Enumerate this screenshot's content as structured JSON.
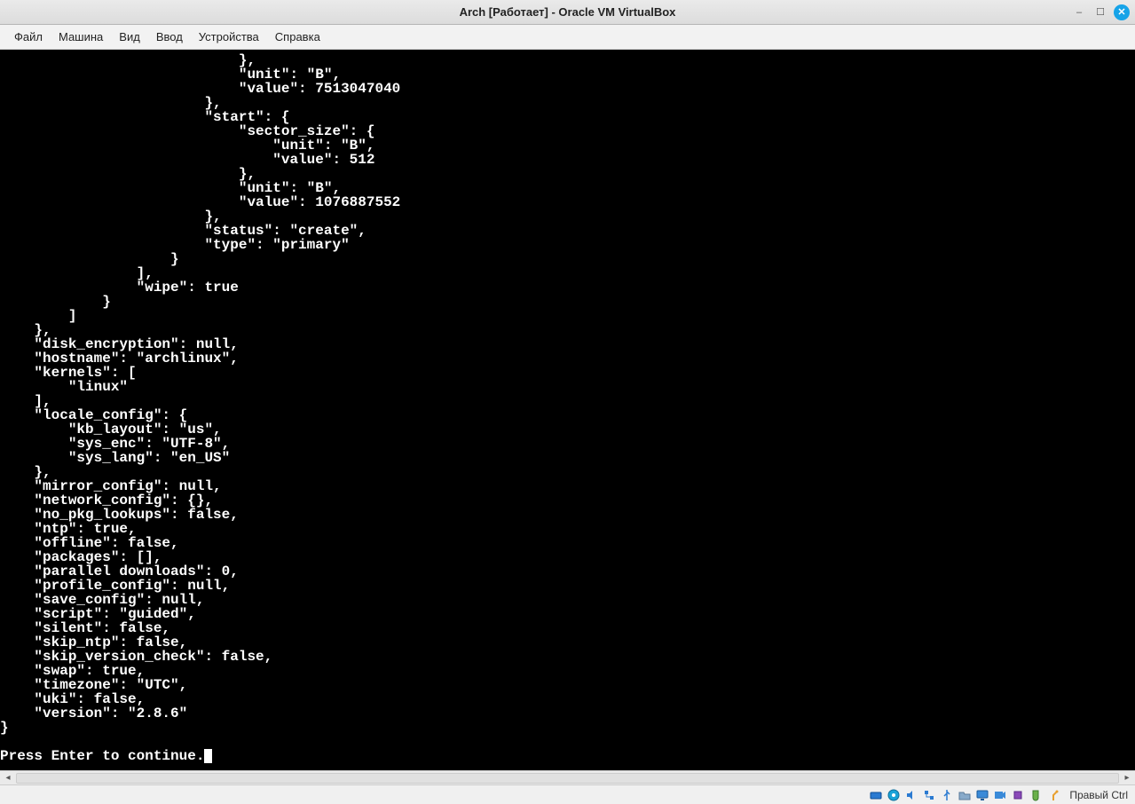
{
  "window": {
    "title": "Arch [Работает] - Oracle VM VirtualBox"
  },
  "menu": {
    "file": "Файл",
    "machine": "Машина",
    "view": "Вид",
    "input": "Ввод",
    "devices": "Устройства",
    "help": "Справка"
  },
  "terminal": {
    "lines": [
      "                            },",
      "                            \"unit\": \"B\",",
      "                            \"value\": 7513047040",
      "                        },",
      "                        \"start\": {",
      "                            \"sector_size\": {",
      "                                \"unit\": \"B\",",
      "                                \"value\": 512",
      "                            },",
      "                            \"unit\": \"B\",",
      "                            \"value\": 1076887552",
      "                        },",
      "                        \"status\": \"create\",",
      "                        \"type\": \"primary\"",
      "                    }",
      "                ],",
      "                \"wipe\": true",
      "            }",
      "        ]",
      "    },",
      "    \"disk_encryption\": null,",
      "    \"hostname\": \"archlinux\",",
      "    \"kernels\": [",
      "        \"linux\"",
      "    ],",
      "    \"locale_config\": {",
      "        \"kb_layout\": \"us\",",
      "        \"sys_enc\": \"UTF-8\",",
      "        \"sys_lang\": \"en_US\"",
      "    },",
      "    \"mirror_config\": null,",
      "    \"network_config\": {},",
      "    \"no_pkg_lookups\": false,",
      "    \"ntp\": true,",
      "    \"offline\": false,",
      "    \"packages\": [],",
      "    \"parallel downloads\": 0,",
      "    \"profile_config\": null,",
      "    \"save_config\": null,",
      "    \"script\": \"guided\",",
      "    \"silent\": false,",
      "    \"skip_ntp\": false,",
      "    \"skip_version_check\": false,",
      "    \"swap\": true,",
      "    \"timezone\": \"UTC\",",
      "    \"uki\": false,",
      "    \"version\": \"2.8.6\"",
      "}",
      "",
      "Press Enter to continue."
    ]
  },
  "statusbar": {
    "hostkey": "Правый Ctrl"
  }
}
